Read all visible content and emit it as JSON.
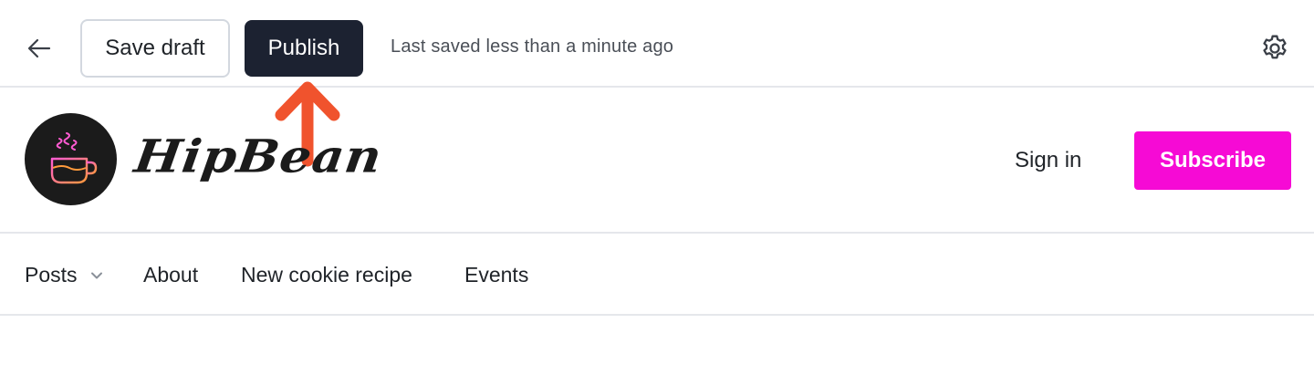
{
  "toolbar": {
    "back_icon": "arrow-left-icon",
    "save_label": "Save draft",
    "publish_label": "Publish",
    "status_text": "Last saved less than a minute ago",
    "settings_icon": "gear-icon"
  },
  "annotation": {
    "icon": "arrow-up-icon",
    "color": "#f0532d"
  },
  "header": {
    "brand_name": "HipBean",
    "logo_icon": "coffee-cup-icon",
    "signin_label": "Sign in",
    "subscribe_label": "Subscribe",
    "accent_color": "#f60ad5"
  },
  "nav": {
    "items": [
      {
        "label": "Posts",
        "has_dropdown": true
      },
      {
        "label": "About"
      },
      {
        "label": "New cookie recipe"
      },
      {
        "label": "Events"
      }
    ]
  }
}
